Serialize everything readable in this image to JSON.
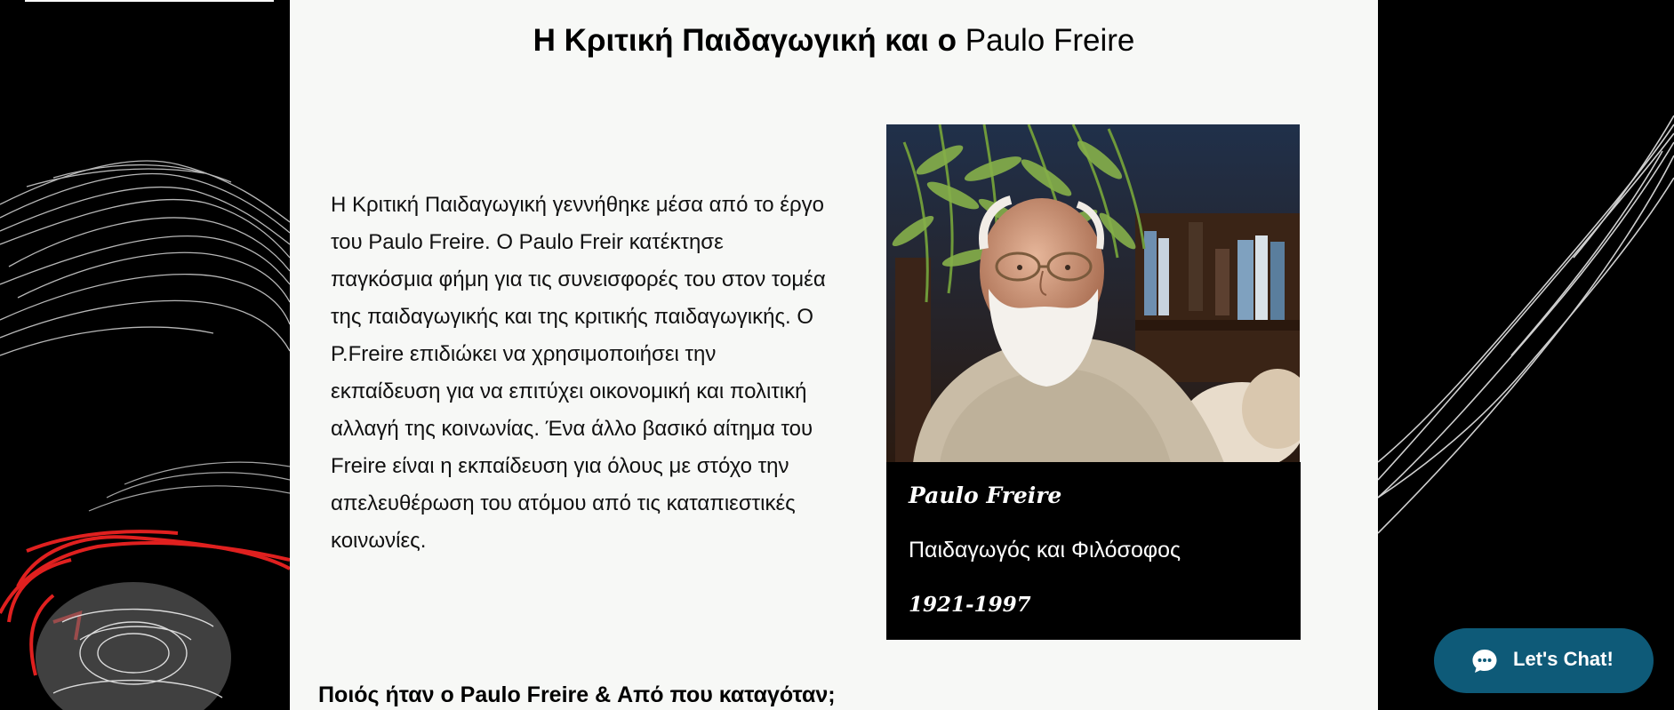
{
  "page": {
    "title_bold": "Η Κριτική Παιδαγωγική και ο",
    "title_rest": " Paulo Freire",
    "intro_text": "Η Κριτική Παιδαγωγική γεννήθηκε μέσα από το έργο του Paulo Freire. Ο Paulo Freir κατέκτησε παγκόσμια φήμη για τις συνεισφορές του στον τομέα της παιδαγωγικής και της κριτικής παιδαγωγικής. Ο P.Freire επιδιώκει να χρησιμοποιήσει την εκπαίδευση για να επιτύχει οικονομική και πολιτική αλλαγή της κοινωνίας. Ένα άλλο βασικό αίτημα του Freire είναι η εκπαίδευση για όλους με στόχο την απελευθέρωση του ατόμου από τις καταπιεστικές κοινωνίες.",
    "subheading": "Ποιός ήταν ο Paulo Freire & Από που καταγόταν;"
  },
  "card": {
    "name": "Paulo Freire",
    "role": "Παιδαγωγός και Φιλόσοφος",
    "years": "1921-1997"
  },
  "chat": {
    "label": "Let's Chat!",
    "icon": "chat-bubble-icon",
    "color": "#0e5a78"
  },
  "colors": {
    "panel_bg": "#f7f8f6",
    "page_bg": "#000000",
    "accent_red": "#e0201f"
  }
}
